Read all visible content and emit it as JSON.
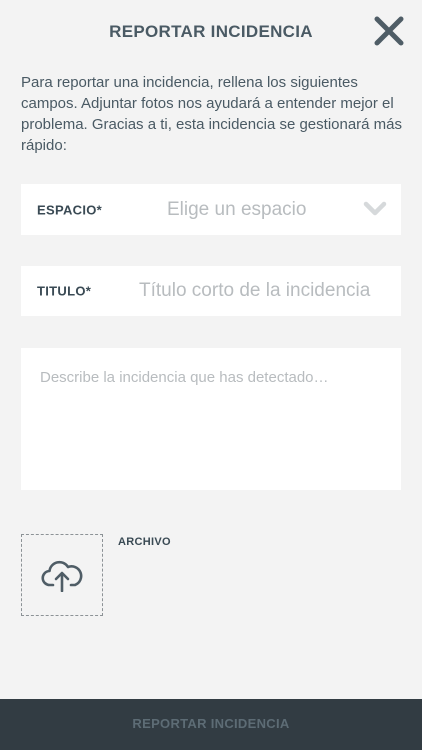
{
  "header": {
    "title": "REPORTAR INCIDENCIA",
    "close_icon": "close-icon"
  },
  "intro": {
    "text": "Para reportar una incidencia, rellena los siguientes campos. Adjuntar fotos nos ayudará a entender mejor el problema. Gracias a ti, esta incidencia se gestionará más rápido:"
  },
  "form": {
    "espacio": {
      "label": "ESPACIO*",
      "placeholder": "Elige un espacio",
      "icon": "chevron-down-icon"
    },
    "titulo": {
      "label": "TITULO*",
      "placeholder": "Título corto de la incidencia"
    },
    "descripcion": {
      "placeholder": "Describe la incidencia que has detectado…"
    },
    "archivo": {
      "label": "ARCHIVO",
      "icon": "cloud-upload-icon"
    }
  },
  "footer": {
    "submit_label": "REPORTAR INCIDENCIA"
  },
  "colors": {
    "background": "#f3f3f3",
    "text": "#4a5a64",
    "placeholder": "#b8bcbf",
    "footer_bg": "#323c43",
    "footer_text": "#5d6c75"
  }
}
